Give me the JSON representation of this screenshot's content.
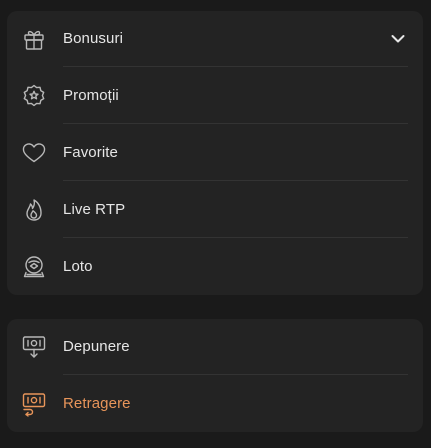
{
  "menu_primary": {
    "items": [
      {
        "label": "Bonusuri",
        "icon": "gift-icon",
        "expandable": true
      },
      {
        "label": "Promoții",
        "icon": "badge-star-icon"
      },
      {
        "label": "Favorite",
        "icon": "heart-icon"
      },
      {
        "label": "Live RTP",
        "icon": "flame-icon"
      },
      {
        "label": "Loto",
        "icon": "lottery-ball-icon"
      }
    ]
  },
  "menu_secondary": {
    "items": [
      {
        "label": "Depunere",
        "icon": "deposit-icon"
      },
      {
        "label": "Retragere",
        "icon": "withdraw-icon",
        "active": true
      }
    ]
  },
  "colors": {
    "background": "#1a1a1a",
    "card": "#232323",
    "text": "#e6e6e6",
    "icon": "#b8b8b8",
    "accent": "#e8955a"
  }
}
